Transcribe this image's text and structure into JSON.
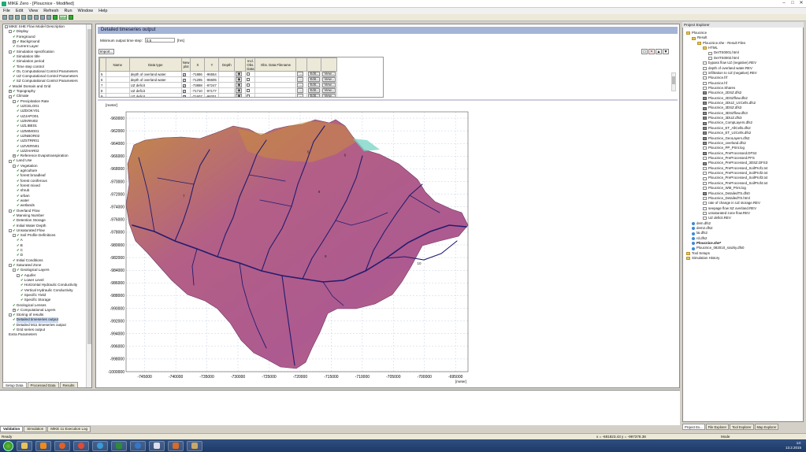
{
  "window": {
    "title": "MIKE Zero - [Plouc﻿nice - Modified]"
  },
  "menu": [
    "File",
    "Edit",
    "View",
    "Refresh",
    "Run",
    "Window",
    "Help"
  ],
  "left_tree": [
    {
      "l": 0,
      "e": "-",
      "c": false,
      "t": "MIKE SHE Flow Model Description"
    },
    {
      "l": 1,
      "e": "-",
      "c": true,
      "t": "Display"
    },
    {
      "l": 2,
      "e": "",
      "c": true,
      "t": "Foreground"
    },
    {
      "l": 2,
      "e": "+",
      "c": true,
      "t": "Background"
    },
    {
      "l": 2,
      "e": "",
      "c": true,
      "t": "Current Layer"
    },
    {
      "l": 1,
      "e": "-",
      "c": true,
      "t": "Simulation specification"
    },
    {
      "l": 2,
      "e": "",
      "c": true,
      "t": "Simulation title"
    },
    {
      "l": 2,
      "e": "",
      "c": true,
      "t": "Simulation period"
    },
    {
      "l": 2,
      "e": "",
      "c": true,
      "t": "Time step control"
    },
    {
      "l": 2,
      "e": "",
      "c": true,
      "t": "OL Computational Control Parameters"
    },
    {
      "l": 2,
      "e": "",
      "c": true,
      "t": "UZ Computational Control Parameters"
    },
    {
      "l": 2,
      "e": "",
      "c": true,
      "t": "SZ Computational Control Parameters"
    },
    {
      "l": 1,
      "e": "",
      "c": true,
      "t": "Model Domain and Grid"
    },
    {
      "l": 1,
      "e": "+",
      "c": true,
      "t": "Topography"
    },
    {
      "l": 1,
      "e": "-",
      "c": true,
      "t": "Climate"
    },
    {
      "l": 2,
      "e": "-",
      "c": true,
      "t": "Precipitation Rate"
    },
    {
      "l": 3,
      "e": "",
      "c": true,
      "t": "UZCELO01"
    },
    {
      "l": 3,
      "e": "",
      "c": true,
      "t": "UZDOKY01"
    },
    {
      "l": 3,
      "e": "",
      "c": true,
      "t": "UZJAPO01"
    },
    {
      "l": 3,
      "e": "",
      "c": true,
      "t": "UZKRNI02"
    },
    {
      "l": 3,
      "e": "",
      "c": true,
      "t": "UZLIBE01"
    },
    {
      "l": 3,
      "e": "",
      "c": true,
      "t": "UZMIMO01"
    },
    {
      "l": 3,
      "e": "",
      "c": true,
      "t": "UZNBOR02"
    },
    {
      "l": 3,
      "e": "",
      "c": true,
      "t": "UZSTRR01"
    },
    {
      "l": 3,
      "e": "",
      "c": true,
      "t": "UZVERN01"
    },
    {
      "l": 3,
      "e": "",
      "c": true,
      "t": "UZZHAR02"
    },
    {
      "l": 2,
      "e": "+",
      "c": true,
      "t": "Reference Evapotranspiration"
    },
    {
      "l": 1,
      "e": "-",
      "c": true,
      "t": "Land Use"
    },
    {
      "l": 2,
      "e": "-",
      "c": true,
      "t": "Vegetation"
    },
    {
      "l": 3,
      "e": "",
      "c": true,
      "t": "agriculture"
    },
    {
      "l": 3,
      "e": "",
      "c": true,
      "t": "forest broadleaf"
    },
    {
      "l": 3,
      "e": "",
      "c": true,
      "t": "forest coniferous"
    },
    {
      "l": 3,
      "e": "",
      "c": true,
      "t": "forest mixed"
    },
    {
      "l": 3,
      "e": "",
      "c": true,
      "t": "shrub"
    },
    {
      "l": 3,
      "e": "",
      "c": true,
      "t": "urban"
    },
    {
      "l": 3,
      "e": "",
      "c": true,
      "t": "water"
    },
    {
      "l": 3,
      "e": "",
      "c": true,
      "t": "wetlands"
    },
    {
      "l": 1,
      "e": "-",
      "c": true,
      "t": "Overland Flow"
    },
    {
      "l": 2,
      "e": "",
      "c": true,
      "t": "Manning Number"
    },
    {
      "l": 2,
      "e": "",
      "c": true,
      "t": "Detention Storage"
    },
    {
      "l": 2,
      "e": "",
      "c": true,
      "t": "Initial Water Depth"
    },
    {
      "l": 1,
      "e": "-",
      "c": true,
      "t": "Unsaturated Flow"
    },
    {
      "l": 2,
      "e": "-",
      "c": true,
      "t": "Soil Profile Definitions"
    },
    {
      "l": 3,
      "e": "",
      "c": true,
      "t": "A"
    },
    {
      "l": 3,
      "e": "",
      "c": true,
      "t": "B"
    },
    {
      "l": 3,
      "e": "",
      "c": true,
      "t": "C"
    },
    {
      "l": 3,
      "e": "",
      "c": true,
      "t": "D"
    },
    {
      "l": 2,
      "e": "",
      "c": true,
      "t": "Initial Conditions"
    },
    {
      "l": 1,
      "e": "-",
      "c": true,
      "t": "Saturated Zone"
    },
    {
      "l": 2,
      "e": "-",
      "c": true,
      "t": "Geological Layers"
    },
    {
      "l": 3,
      "e": "-",
      "c": true,
      "t": "Aquifer"
    },
    {
      "l": 4,
      "e": "",
      "c": true,
      "t": "Lower Level"
    },
    {
      "l": 4,
      "e": "",
      "c": true,
      "t": "Horizontal Hydraulic Conductivity"
    },
    {
      "l": 4,
      "e": "",
      "c": true,
      "t": "Vertical Hydraulic Conductivity"
    },
    {
      "l": 4,
      "e": "",
      "c": true,
      "t": "Specific Yield"
    },
    {
      "l": 4,
      "e": "",
      "c": true,
      "t": "Specific Storage"
    },
    {
      "l": 2,
      "e": "",
      "c": true,
      "t": "Geological Lenses"
    },
    {
      "l": 2,
      "e": "+",
      "c": true,
      "t": "Computational Layers"
    },
    {
      "l": 1,
      "e": "-",
      "c": true,
      "t": "Storing of results"
    },
    {
      "l": 2,
      "e": "",
      "c": true,
      "t": "Detailed timeseries output",
      "sel": true
    },
    {
      "l": 2,
      "e": "",
      "c": true,
      "t": "Detailed M11 timeseries output"
    },
    {
      "l": 2,
      "e": "",
      "c": true,
      "t": "Grid series output"
    },
    {
      "l": 1,
      "e": "",
      "c": false,
      "t": "Extra Parameters"
    }
  ],
  "left_tabs": [
    "Setup Data",
    "Processed Data",
    "Results"
  ],
  "panel": {
    "title": "Detailed timeseries output",
    "timestep_label": "Minimum output time step:",
    "timestep_value": "0.5",
    "timestep_unit": "[hrs]",
    "import_label": "Import...",
    "columns": [
      "",
      "Name",
      "Data type",
      "New plot",
      "X",
      "Y",
      "Depth",
      "",
      "Incl. Obs. Data",
      "Obs. Data Filename",
      "",
      "",
      ""
    ],
    "rows": [
      {
        "n": "5",
        "dt": "depth of overland water",
        "x": "-71886",
        "y": "-96554"
      },
      {
        "n": "6",
        "dt": "depth of overland water",
        "x": "-71295",
        "y": "-96605"
      },
      {
        "n": "7",
        "dt": "UZ deficit",
        "x": "-73888",
        "y": "-97247"
      },
      {
        "n": "8",
        "dt": "UZ deficit",
        "x": "-71710",
        "y": "-97177"
      },
      {
        "n": "9",
        "dt": "UZ deficit",
        "x": "-71607",
        "y": "-98201"
      },
      {
        "n": "10",
        "dt": "UZ deficit",
        "x": "-70117",
        "y": "-98311"
      }
    ],
    "edit_label": "Edit...",
    "view_label": "View..."
  },
  "map": {
    "unit_label": "[meter]",
    "xunit": "[meter]"
  },
  "chart_data": {
    "type": "heatmap",
    "xlabel": "[meter]",
    "ylabel": "[meter]",
    "xlim": [
      -748000,
      -693000
    ],
    "ylim": [
      -1000000,
      -959000
    ],
    "xticks": [
      -745000,
      -740000,
      -735000,
      -730000,
      -725000,
      -720000,
      -715000,
      -710000,
      -705000,
      -700000,
      -695000
    ],
    "yticks": [
      -960000,
      -962000,
      -964000,
      -966000,
      -968000,
      -970000,
      -972000,
      -974000,
      -976000,
      -978000,
      -980000,
      -982000,
      -984000,
      -986000,
      -988000,
      -990000,
      -992000,
      -994000,
      -996000,
      -998000,
      -1000000
    ],
    "point_labels": [
      "5",
      "6",
      "7",
      "8",
      "9",
      "10"
    ],
    "grid": true,
    "colors": {
      "catchment": "#b45a8c",
      "highlands": "#c6853c",
      "rivers": "#1e1a78"
    }
  },
  "project": {
    "header": "Project Explorer",
    "items": [
      {
        "l": 0,
        "i": "folder",
        "t": "Plouc﻿nice"
      },
      {
        "l": 1,
        "i": "folder",
        "t": "Result"
      },
      {
        "l": 2,
        "i": "folder",
        "t": "Plouc﻿nice.she - Result Files"
      },
      {
        "l": 3,
        "i": "folder",
        "t": "HTML"
      },
      {
        "l": 4,
        "i": "doc",
        "t": "DetTS0001.html"
      },
      {
        "l": 4,
        "i": "doc",
        "t": "DetTS0002.html"
      },
      {
        "l": 3,
        "i": "doc",
        "t": "bypass flow UZ (negative).REV"
      },
      {
        "l": 3,
        "i": "doc",
        "t": "depth of overland water.REV"
      },
      {
        "l": 3,
        "i": "doc",
        "t": "infiltration to UZ (negative).REV"
      },
      {
        "l": 3,
        "i": "doc",
        "t": "Plouc﻿nice.frf"
      },
      {
        "l": 3,
        "i": "doc",
        "t": "Plouc﻿nice.hf"
      },
      {
        "l": 3,
        "i": "doc",
        "t": "Plouc﻿nice.Shares"
      },
      {
        "l": 3,
        "i": "grid",
        "t": "Plouc﻿nice_2DSZ.dfs2"
      },
      {
        "l": 3,
        "i": "grid",
        "t": "Plouc﻿nice_2DSZflow.dfs2"
      },
      {
        "l": 3,
        "i": "grid",
        "t": "Plouc﻿nice_2DUZ_UzCells.dfs2"
      },
      {
        "l": 3,
        "i": "grid",
        "t": "Plouc﻿nice_3DSZ.dfs3"
      },
      {
        "l": 3,
        "i": "grid",
        "t": "Plouc﻿nice_3DSZflow.dfs3"
      },
      {
        "l": 3,
        "i": "grid",
        "t": "Plouc﻿nice_3DUZ.dfs3"
      },
      {
        "l": 3,
        "i": "grid",
        "t": "Plouc﻿nice_CompLayers.dfs2"
      },
      {
        "l": 3,
        "i": "grid",
        "t": "Plouc﻿nice_ET_AllCells.dfs2"
      },
      {
        "l": 3,
        "i": "grid",
        "t": "Plouc﻿nice_ET_UzCells.dfs2"
      },
      {
        "l": 3,
        "i": "grid",
        "t": "Plouc﻿nice_GeoLayers.dfs2"
      },
      {
        "l": 3,
        "i": "grid",
        "t": "Plouc﻿nice_overland.dfs2"
      },
      {
        "l": 3,
        "i": "doc",
        "t": "Plouc﻿nice_PP_Print.log"
      },
      {
        "l": 3,
        "i": "grid",
        "t": "Plouc﻿nice_PreProcessed.DFS2"
      },
      {
        "l": 3,
        "i": "doc",
        "t": "Plouc﻿nice_PreProcessed.PFS"
      },
      {
        "l": 3,
        "i": "grid",
        "t": "Plouc﻿nice_PreProcessed_3DSZ.DFS3"
      },
      {
        "l": 3,
        "i": "doc",
        "t": "Plouc﻿nice_PreProcessed_SoilProf1.txt"
      },
      {
        "l": 3,
        "i": "doc",
        "t": "Plouc﻿nice_PreProcessed_SoilProf2.txt"
      },
      {
        "l": 3,
        "i": "doc",
        "t": "Plouc﻿nice_PreProcessed_SoilProf3.txt"
      },
      {
        "l": 3,
        "i": "doc",
        "t": "Plouc﻿nice_PreProcessed_SoilProf4.txt"
      },
      {
        "l": 3,
        "i": "doc",
        "t": "Plouc﻿nice_WM_Print.log"
      },
      {
        "l": 3,
        "i": "grid",
        "t": "Plouc﻿nice_DetailedTS.dfs0"
      },
      {
        "l": 3,
        "i": "doc",
        "t": "Plouc﻿nice_DetailedTS.html"
      },
      {
        "l": 3,
        "i": "doc",
        "t": "rate of change in UZ storage.REV"
      },
      {
        "l": 3,
        "i": "doc",
        "t": "seepage flow SZ overland.REV"
      },
      {
        "l": 3,
        "i": "doc",
        "t": "unsaturated zone flow.REV"
      },
      {
        "l": 3,
        "i": "doc",
        "t": "UZ deficit.REV"
      },
      {
        "l": 1,
        "i": "globe",
        "t": "dem.dfs2"
      },
      {
        "l": 1,
        "i": "globe",
        "t": "dem2.dfs2"
      },
      {
        "l": 1,
        "i": "globe",
        "t": "lai.dfs2"
      },
      {
        "l": 1,
        "i": "globe",
        "t": "rd.dfs2"
      },
      {
        "l": 1,
        "i": "globe",
        "t": "Plouc﻿nice.she*",
        "bold": true
      },
      {
        "l": 1,
        "i": "globe",
        "t": "Plouc﻿nice_082010_srazky.dfs0"
      },
      {
        "l": 0,
        "i": "folder",
        "t": "Tool Setups"
      },
      {
        "l": 0,
        "i": "folder",
        "t": "Simulation History"
      }
    ],
    "tabs": [
      "Project Ex...",
      "File Explorer",
      "Tool Explorer",
      "Map Explorer"
    ]
  },
  "bottom_tabs": [
    "Validation",
    "Simulation",
    "MIKE 11 Execution Log"
  ],
  "status": {
    "left": "Ready",
    "coords": "x = -681823.43   y = -997378.38",
    "mode": "Mode"
  },
  "tray": {
    "time": "13:",
    "date": "13.2.2015"
  }
}
